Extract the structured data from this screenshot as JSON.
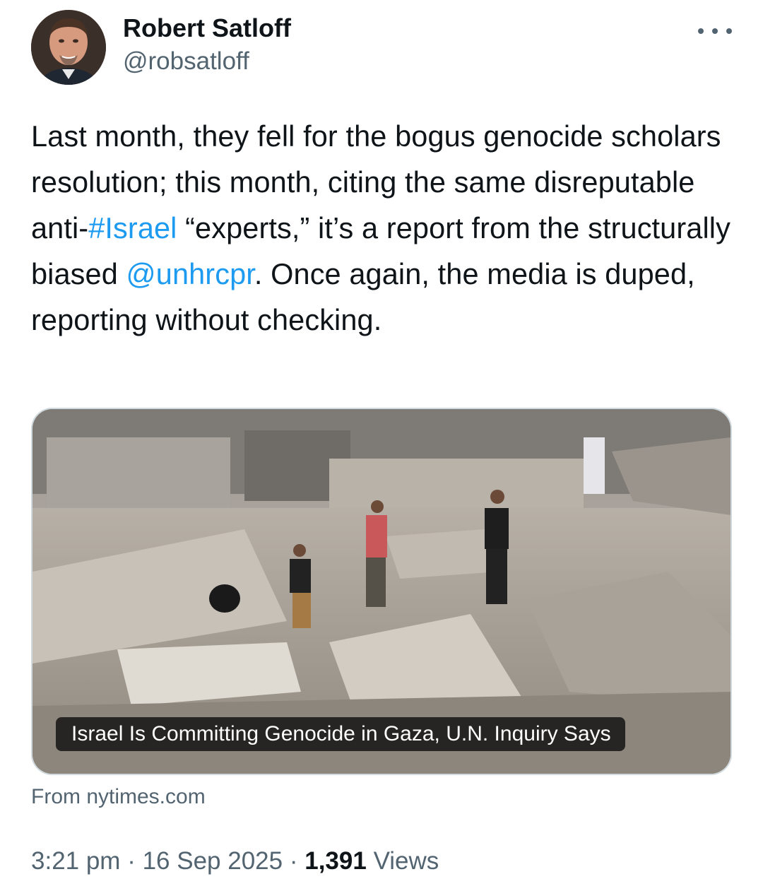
{
  "author": {
    "display_name": "Robert Satloff",
    "handle": "@robsatloff",
    "avatar_icon": "profile-photo"
  },
  "tweet": {
    "text_1": "Last month, they fell for the bogus genocide scholars resolution; this month, citing the same disreputable anti-",
    "hashtag": "#Israel",
    "text_2": " “experts,” it’s a report from the structurally biased ",
    "mention": "@unhrcpr",
    "text_3": ". Once again, the media is duped, reporting without checking."
  },
  "card": {
    "caption": "Israel Is Committing Genocide in Gaza, U.N. Inquiry Says",
    "source": "From nytimes.com"
  },
  "meta": {
    "time": "3:21 pm",
    "separator": "·",
    "date": "16 Sep 2025",
    "views_count": "1,391",
    "views_label": "Views"
  },
  "colors": {
    "link": "#1d9bf0",
    "secondary_text": "#536471",
    "primary_text": "#0f1419",
    "card_border": "#cfd9de"
  }
}
